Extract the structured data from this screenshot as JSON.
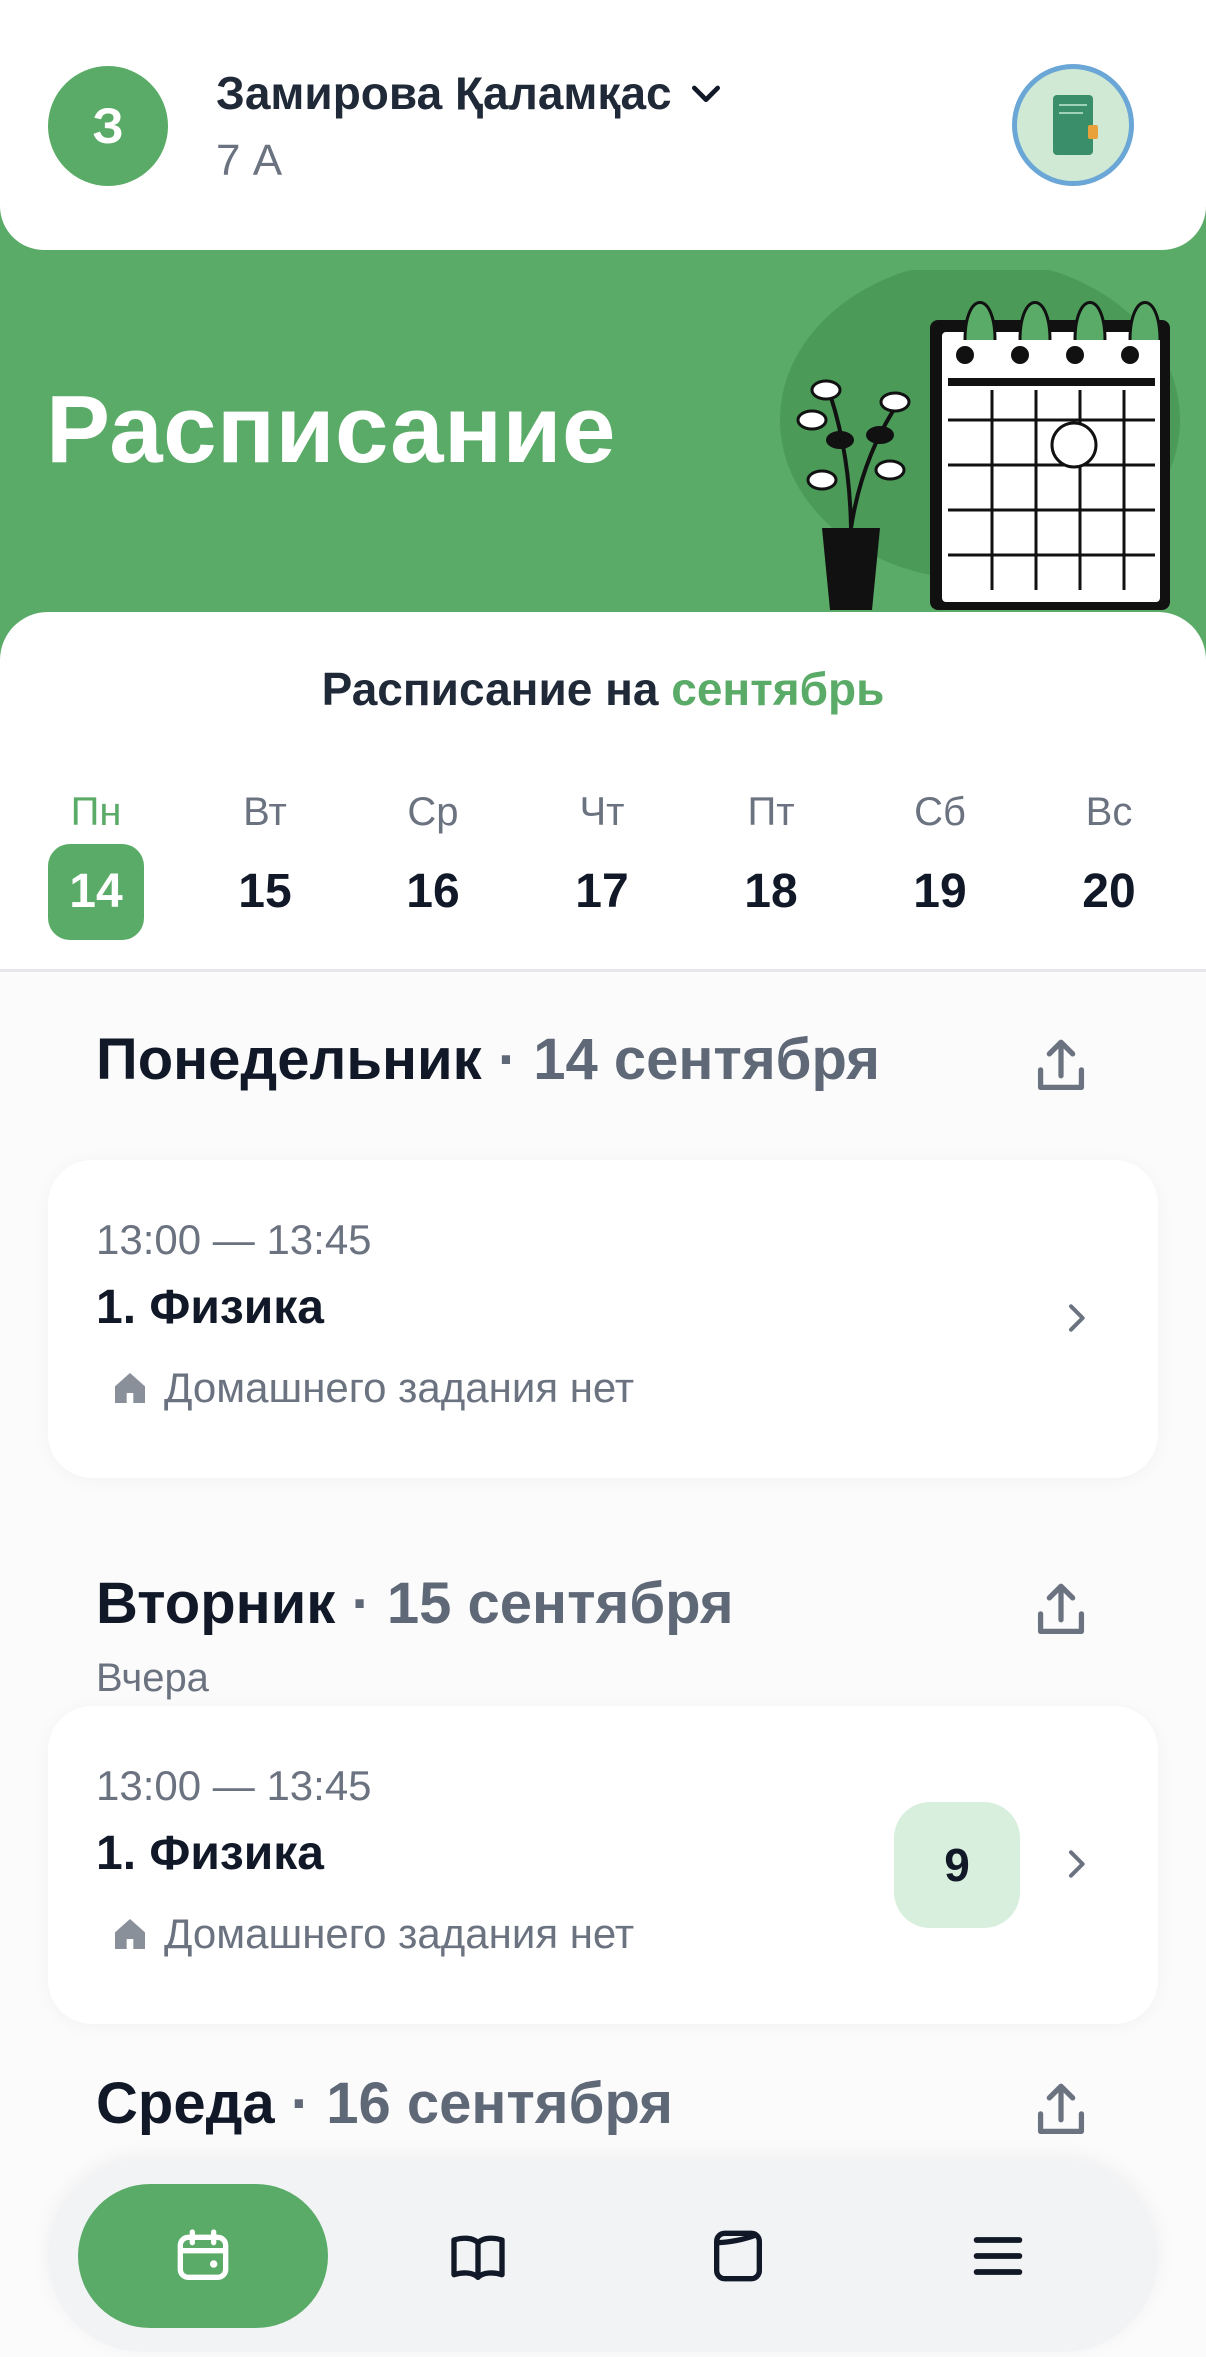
{
  "header": {
    "avatar_letter": "З",
    "user_name": "Замирова Қаламқас",
    "user_class": "7 А"
  },
  "hero": {
    "title": "Расписание"
  },
  "month_selector": {
    "prefix": "Расписание на",
    "month": "сентябрь"
  },
  "week": [
    {
      "name": "Пн",
      "num": "14",
      "active": true
    },
    {
      "name": "Вт",
      "num": "15",
      "active": false
    },
    {
      "name": "Ср",
      "num": "16",
      "active": false
    },
    {
      "name": "Чт",
      "num": "17",
      "active": false
    },
    {
      "name": "Пт",
      "num": "18",
      "active": false
    },
    {
      "name": "Сб",
      "num": "19",
      "active": false
    },
    {
      "name": "Вс",
      "num": "20",
      "active": false
    }
  ],
  "days": [
    {
      "name": "Понедельник",
      "date": "· 14 сентября",
      "sub": "",
      "lessons": [
        {
          "time": "13:00 — 13:45",
          "subject": "1. Физика",
          "homework": "Домашнего задания нет",
          "grade": ""
        }
      ]
    },
    {
      "name": "Вторник",
      "date": "· 15 сентября",
      "sub": "Вчера",
      "lessons": [
        {
          "time": "13:00 — 13:45",
          "subject": "1. Физика",
          "homework": "Домашнего задания нет",
          "grade": "9"
        }
      ]
    },
    {
      "name": "Среда",
      "date": "· 16 сентября",
      "sub": "",
      "lessons": []
    }
  ],
  "nav": [
    {
      "icon": "calendar-icon",
      "active": true
    },
    {
      "icon": "book-icon",
      "active": false
    },
    {
      "icon": "wallet-icon",
      "active": false
    },
    {
      "icon": "menu-icon",
      "active": false
    }
  ],
  "colors": {
    "primary_green": "#5aab67",
    "grade_bg": "#d7efdc",
    "text_dark": "#111827",
    "text_muted": "#6b7280"
  }
}
